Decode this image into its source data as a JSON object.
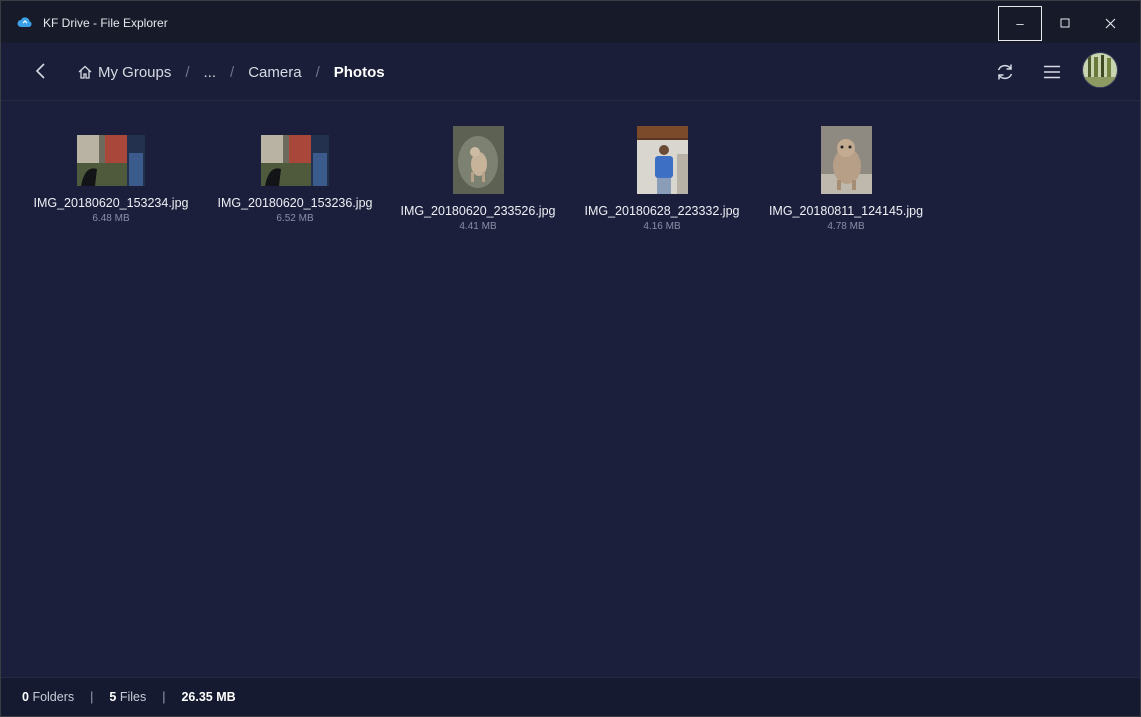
{
  "window": {
    "title": "KF Drive - File Explorer",
    "controls": {
      "minimize": "–",
      "maximize": "□",
      "close": "✕"
    }
  },
  "breadcrumb": {
    "home": "My Groups",
    "ellipsis": "...",
    "parent": "Camera",
    "current": "Photos",
    "separator": "/"
  },
  "files": [
    {
      "name": "IMG_20180620_153234.jpg",
      "size": "6.48 MB",
      "thumb": "wide"
    },
    {
      "name": "IMG_20180620_153236.jpg",
      "size": "6.52 MB",
      "thumb": "wide"
    },
    {
      "name": "IMG_20180620_233526.jpg",
      "size": "4.41 MB",
      "thumb": "tall"
    },
    {
      "name": "IMG_20180628_223332.jpg",
      "size": "4.16 MB",
      "thumb": "tall"
    },
    {
      "name": "IMG_20180811_124145.jpg",
      "size": "4.78 MB",
      "thumb": "tall"
    }
  ],
  "status": {
    "folders_count": "0",
    "folders_label": "Folders",
    "files_count": "5",
    "files_label": "Files",
    "total_size": "26.35 MB",
    "divider": "|"
  },
  "colors": {
    "background": "#1b1f3b",
    "titlebar": "#171a28",
    "accent_cloud": "#3aa0e8"
  }
}
